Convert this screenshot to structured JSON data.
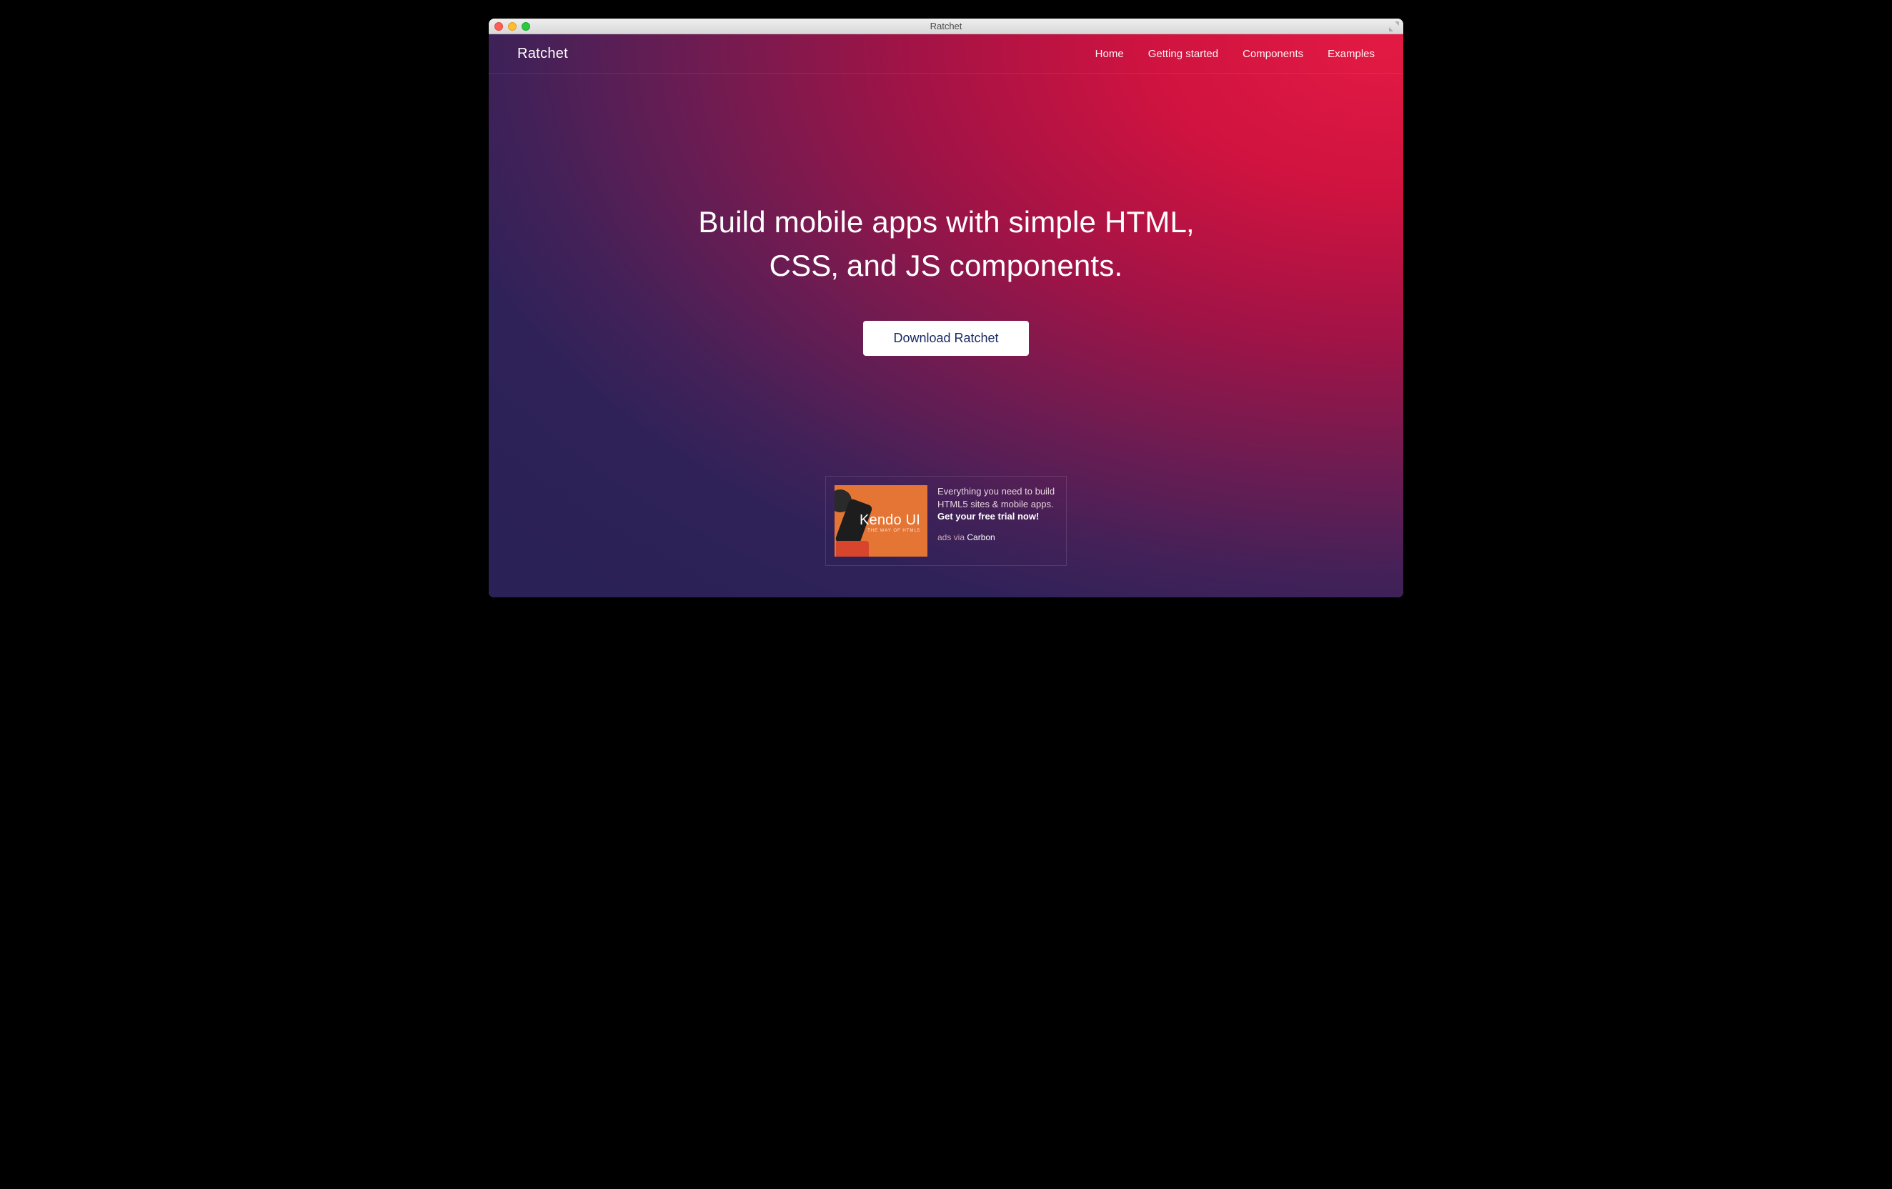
{
  "window": {
    "title": "Ratchet"
  },
  "nav": {
    "brand": "Ratchet",
    "links": [
      {
        "label": "Home"
      },
      {
        "label": "Getting started"
      },
      {
        "label": "Components"
      },
      {
        "label": "Examples"
      }
    ]
  },
  "hero": {
    "headline": "Build mobile apps with simple HTML‚ CSS‚ and JS components.",
    "cta_label": "Download Ratchet"
  },
  "ad": {
    "image_brand": "Kendo UI",
    "image_tagline": "THE WAY OF HTML5",
    "copy_lead": "Everything you need to build HTML5 sites & mobile apps. ",
    "copy_cta": "Get your free trial now!",
    "attrib_prefix": "ads via ",
    "attrib_vendor": "Carbon"
  }
}
